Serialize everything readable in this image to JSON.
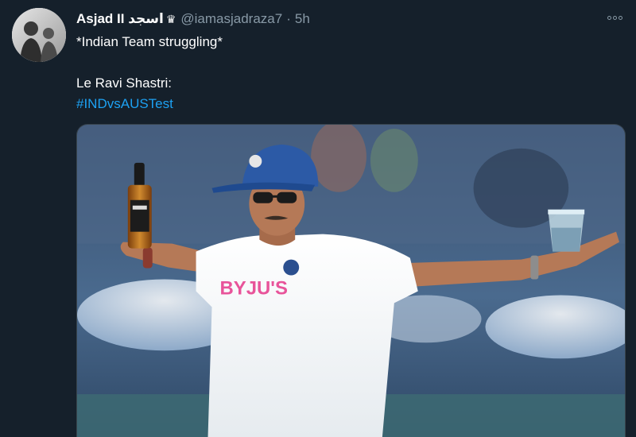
{
  "tweet": {
    "display_name": "Asjad II اسجد",
    "crown_icon": "crown-icon",
    "handle": "@iamasjadraza7",
    "separator": "·",
    "time": "5h",
    "text_line_1": "*Indian Team struggling*",
    "text_line_2": "Le Ravi Shastri:",
    "hashtag": "#INDvsAUSTest",
    "more_icon": "more-horizontal-icon",
    "media_jersey_text": "BYJU'S"
  },
  "colors": {
    "background": "#15202b",
    "secondary_text": "#8899a6",
    "link": "#1da1f2"
  }
}
